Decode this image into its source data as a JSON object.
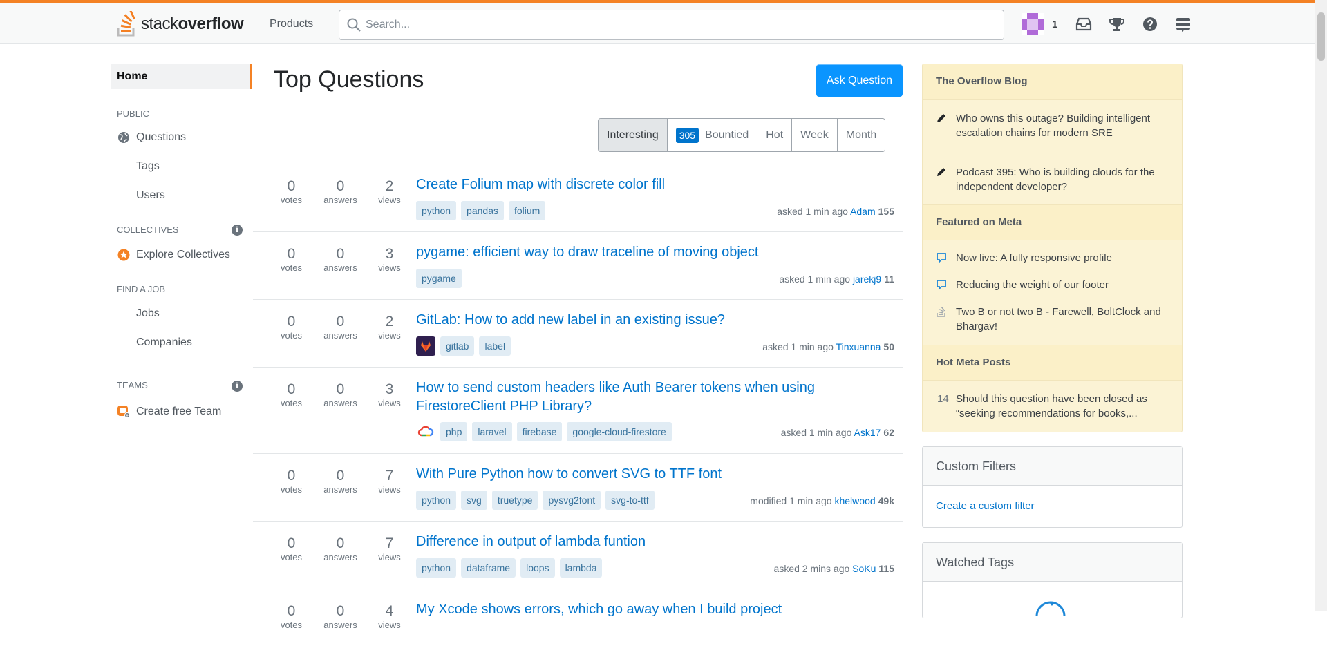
{
  "header": {
    "logo_text_light": "stack",
    "logo_text_bold": "overflow",
    "products_label": "Products",
    "search_placeholder": "Search...",
    "reputation": "1"
  },
  "sidebar": {
    "home": "Home",
    "public_heading": "PUBLIC",
    "questions": "Questions",
    "tags": "Tags",
    "users": "Users",
    "collectives_heading": "COLLECTIVES",
    "explore_collectives": "Explore Collectives",
    "find_job_heading": "FIND A JOB",
    "jobs": "Jobs",
    "companies": "Companies",
    "teams_heading": "TEAMS",
    "create_team": "Create free Team",
    "info_glyph": "i"
  },
  "main": {
    "title": "Top Questions",
    "ask_button": "Ask Question",
    "filters": {
      "interesting": "Interesting",
      "bounty_count": "305",
      "bountied": "Bountied",
      "hot": "Hot",
      "week": "Week",
      "month": "Month",
      "active": "Interesting"
    },
    "stat_labels": {
      "votes": "votes",
      "answers": "answers",
      "views": "views"
    },
    "questions": [
      {
        "votes": "0",
        "answers": "0",
        "views": "2",
        "title": "Create Folium map with discrete color fill",
        "tags": [
          "python",
          "pandas",
          "folium"
        ],
        "action": "asked 1 min ago",
        "user": "Adam",
        "score": "155"
      },
      {
        "votes": "0",
        "answers": "0",
        "views": "3",
        "title": "pygame: efficient way to draw traceline of moving object",
        "tags": [
          "pygame"
        ],
        "action": "asked 1 min ago",
        "user": "jarekj9",
        "score": "11"
      },
      {
        "votes": "0",
        "answers": "0",
        "views": "2",
        "title": "GitLab: How to add new label in an existing issue?",
        "tags": [
          "gitlab",
          "label"
        ],
        "action": "asked 1 min ago",
        "user": "Tinxuanna",
        "score": "50"
      },
      {
        "votes": "0",
        "answers": "0",
        "views": "3",
        "title": "How to send custom headers like Auth Bearer tokens when using FirestoreClient PHP Library?",
        "tags": [
          "php",
          "laravel",
          "firebase",
          "google-cloud-firestore"
        ],
        "action": "asked 1 min ago",
        "user": "Ask17",
        "score": "62"
      },
      {
        "votes": "0",
        "answers": "0",
        "views": "7",
        "title": "With Pure Python how to convert SVG to TTF font",
        "tags": [
          "python",
          "svg",
          "truetype",
          "pysvg2font",
          "svg-to-ttf"
        ],
        "action": "modified 1 min ago",
        "user": "khelwood",
        "score": "49k"
      },
      {
        "votes": "0",
        "answers": "0",
        "views": "7",
        "title": "Difference in output of lambda funtion",
        "tags": [
          "python",
          "dataframe",
          "loops",
          "lambda"
        ],
        "action": "asked 2 mins ago",
        "user": "SoKu",
        "score": "115"
      },
      {
        "votes": "0",
        "answers": "0",
        "views": "4",
        "title": "My Xcode shows errors, which go away when I build project",
        "tags": [],
        "action": "",
        "user": "",
        "score": ""
      }
    ]
  },
  "right": {
    "blog_heading": "The Overflow Blog",
    "blog_items": [
      "Who owns this outage? Building intelligent escalation chains for modern SRE",
      "Podcast 395: Who is building clouds for the independent developer?"
    ],
    "meta_heading": "Featured on Meta",
    "meta_items": [
      "Now live: A fully responsive profile",
      "Reducing the weight of our footer",
      "Two B or not two B - Farewell, BoltClock and Bhargav!"
    ],
    "hot_heading": "Hot Meta Posts",
    "hot_items": [
      {
        "count": "14",
        "text": "Should this question have been closed as “seeking recommendations for books,..."
      }
    ],
    "custom_filters_heading": "Custom Filters",
    "custom_filter_link": "Create a custom filter",
    "watched_tags_heading": "Watched Tags"
  },
  "colors": {
    "accent": "#f48225",
    "link": "#0074cc",
    "button": "#0a95ff",
    "tag_bg": "#e1ecf4",
    "tag_text": "#39739d",
    "blog_bg": "#fbf3d5"
  }
}
